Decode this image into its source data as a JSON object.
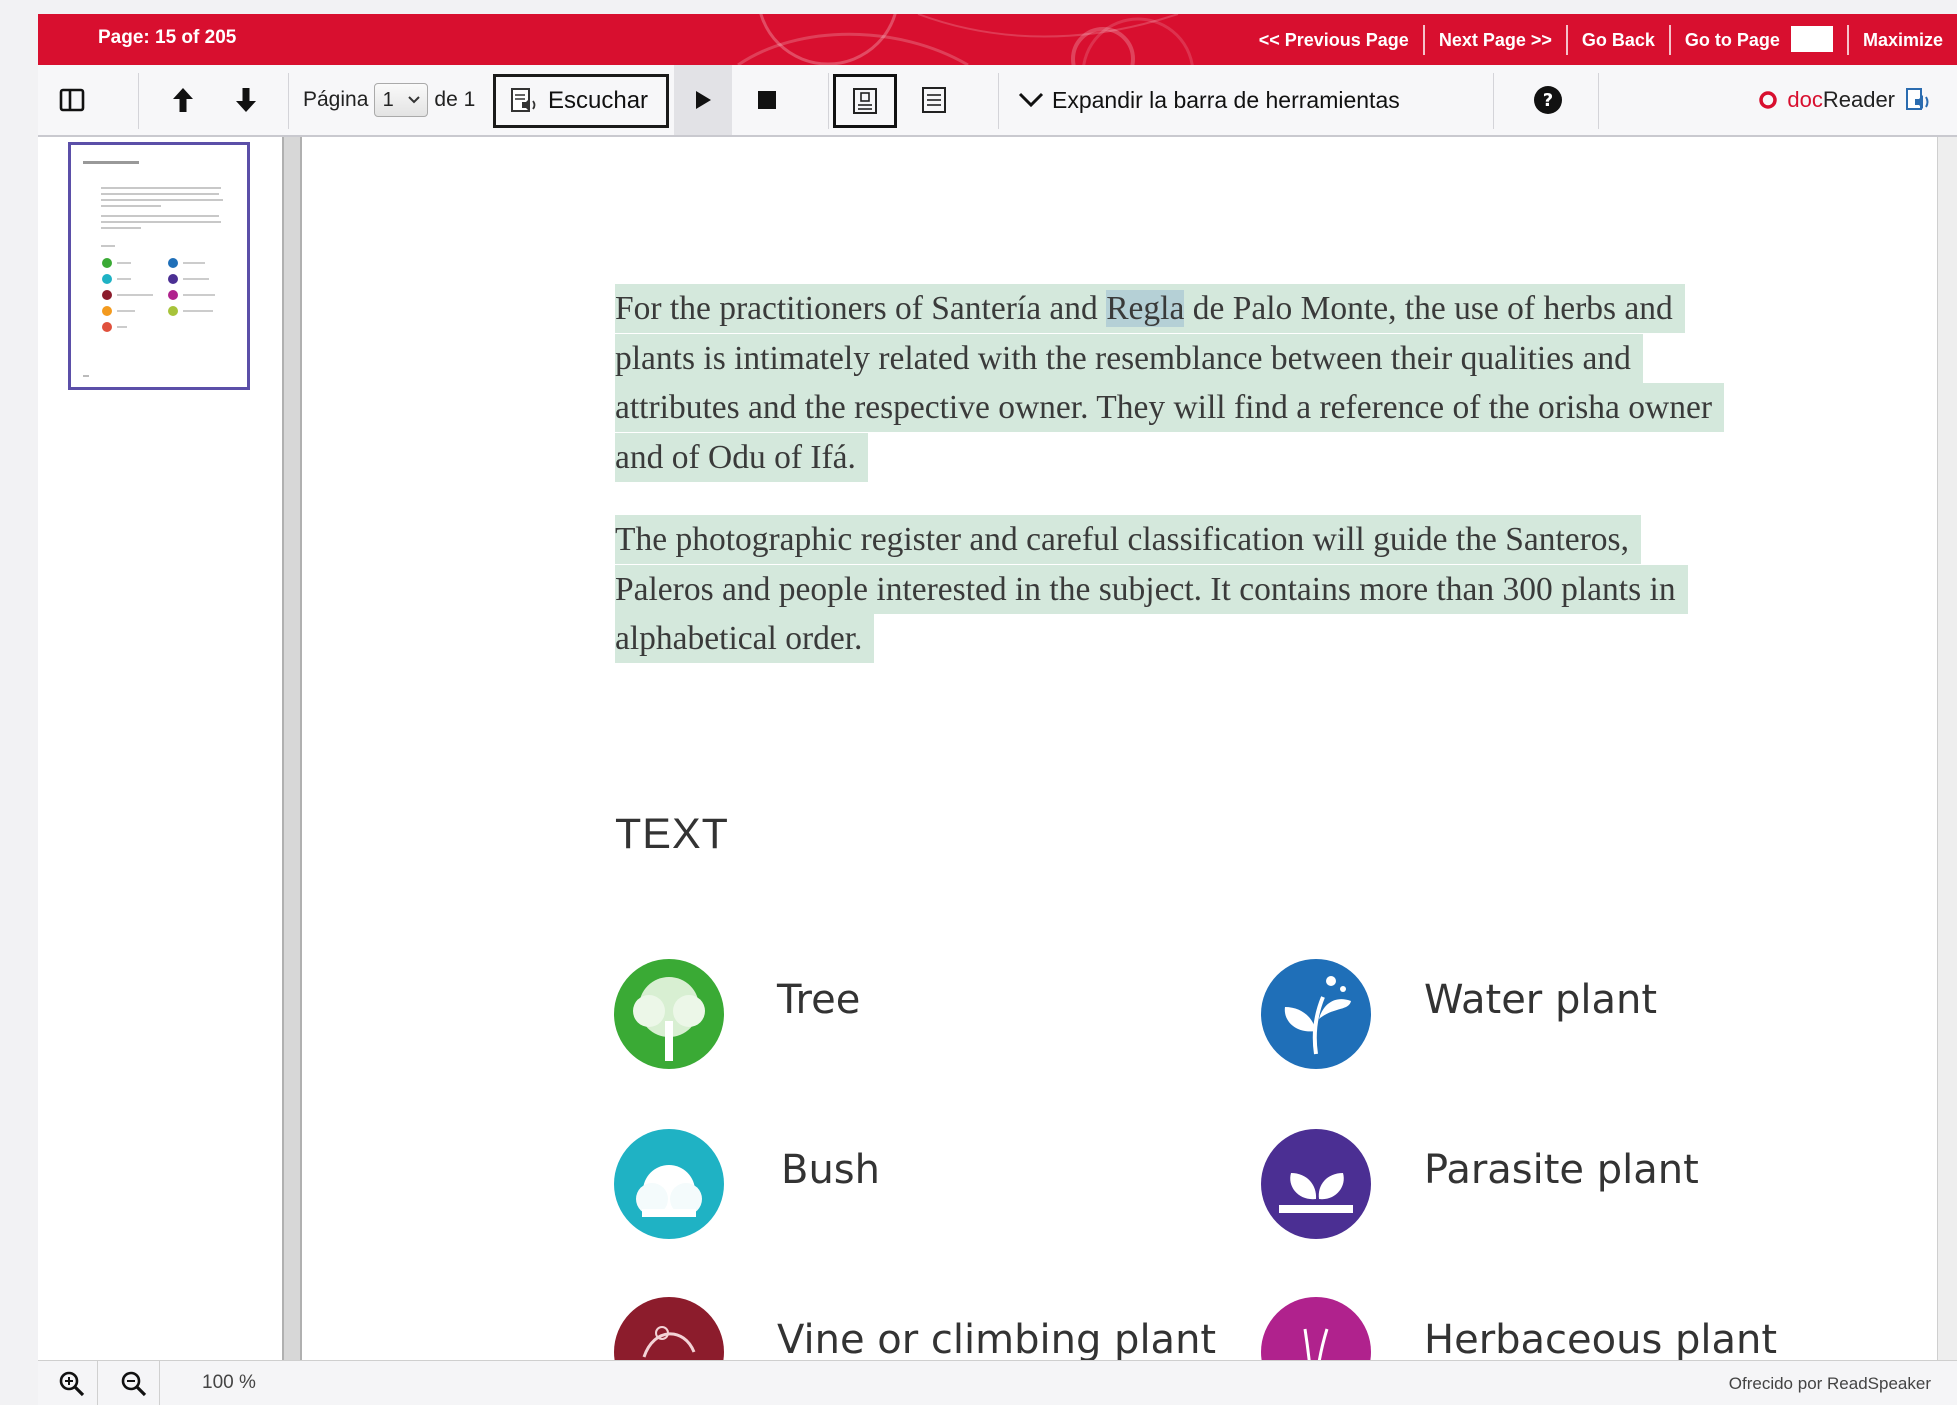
{
  "topbar": {
    "page_info": "Page: 15 of 205",
    "links": {
      "previous": "<< Previous Page",
      "next": "Next Page >>",
      "back": "Go Back",
      "goto": "Go to Page",
      "maximize": "Maximize"
    }
  },
  "toolbar": {
    "page_label": "Página",
    "page_value": "1",
    "page_of": "de 1",
    "listen": "Escuchar",
    "expand": "Expandir la barra de herramientas",
    "brand_doc": "doc",
    "brand_reader": "Reader"
  },
  "document": {
    "para1": {
      "line1_a": "For the practitioners of Santería and ",
      "line1_word": "Regla",
      "line1_b": " de Palo Monte, the use of herbs and",
      "line2": "plants is intimately related with the resemblance between their qualities and",
      "line3": "attributes and the respective owner. They will find a reference of the orisha owner",
      "line4": "and of Odu of Ifá."
    },
    "para2": {
      "line1": "The photographic register and careful classification will guide the Santeros,",
      "line2": "Paleros and people interested in the subject. It contains more than 300 plants in",
      "line3": "alphabetical order."
    },
    "section_heading": "TEXT",
    "legend": [
      {
        "label": "Tree",
        "icon": "tree-icon",
        "color": "#3aaa35"
      },
      {
        "label": "Water plant",
        "icon": "water-plant-icon",
        "color": "#1f6fb8"
      },
      {
        "label": "Bush",
        "icon": "bush-icon",
        "color": "#1fb2c4"
      },
      {
        "label": "Parasite plant",
        "icon": "parasite-plant-icon",
        "color": "#4b2f93"
      },
      {
        "label": "Vine or climbing plant",
        "icon": "vine-icon",
        "color": "#8c1c2c"
      },
      {
        "label": "Herbaceous plant",
        "icon": "herbaceous-plant-icon",
        "color": "#b0228d"
      }
    ]
  },
  "bottombar": {
    "zoom": "100 %",
    "credit": "Ofrecido por ReadSpeaker"
  },
  "colors": {
    "topbar": "#d80f2f",
    "highlight": "#d4e8dc",
    "current_word": "#b5d0d6",
    "thumbnail_border": "#5b4fa8"
  }
}
